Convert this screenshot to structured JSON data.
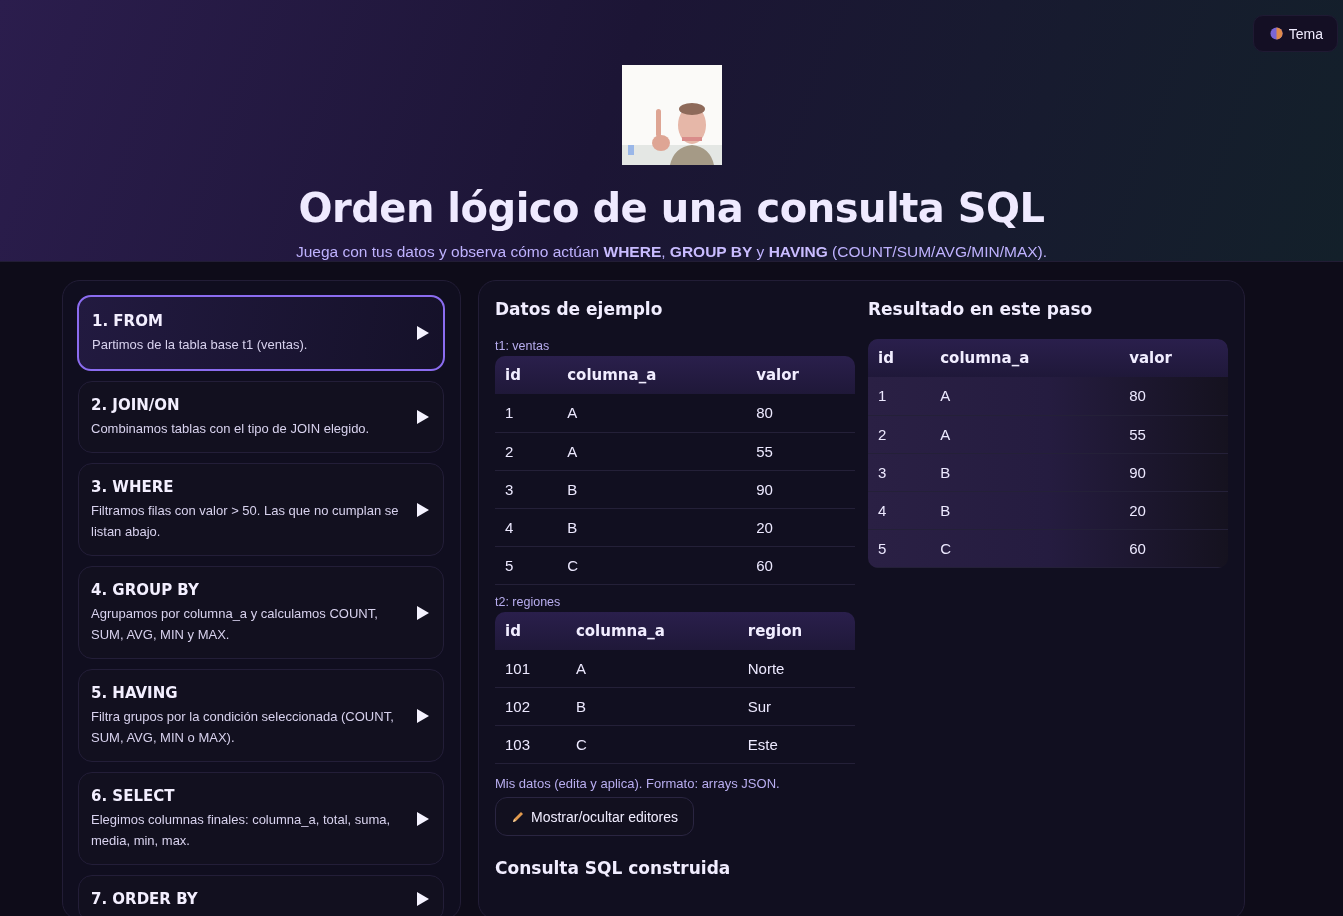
{
  "theme_button": {
    "label": "Tema"
  },
  "header": {
    "title": "Orden lógico de una consulta SQL",
    "subtitle": "Juega con tus datos y observa cómo actúan **WHERE**, **GROUP BY** y **HAVING** (COUNT/SUM/AVG/MIN/MAX)."
  },
  "steps": [
    {
      "title": "1. FROM",
      "description": "Partimos de la tabla base t1 (ventas).",
      "selected": true
    },
    {
      "title": "2. JOIN/ON",
      "description": "Combinamos tablas con el tipo de JOIN elegido.",
      "selected": false
    },
    {
      "title": "3. WHERE",
      "description": "Filtramos filas con valor > 50. Las que no cumplan se listan abajo.",
      "selected": false
    },
    {
      "title": "4. GROUP BY",
      "description": "Agrupamos por columna_a y calculamos COUNT, SUM, AVG, MIN y MAX.",
      "selected": false
    },
    {
      "title": "5. HAVING",
      "description": "Filtra grupos por la condición seleccionada (COUNT, SUM, AVG, MIN o MAX).",
      "selected": false
    },
    {
      "title": "6. SELECT",
      "description": "Elegimos columnas finales: columna_a, total, suma, media, min, max.",
      "selected": false
    },
    {
      "title": "7. ORDER BY",
      "selected": false
    }
  ],
  "sample_data": {
    "title": "Datos de ejemplo",
    "tables": [
      {
        "caption": "t1: ventas",
        "columns": [
          "id",
          "columna_a",
          "valor"
        ],
        "rows": [
          [
            "1",
            "A",
            "80"
          ],
          [
            "2",
            "A",
            "55"
          ],
          [
            "3",
            "B",
            "90"
          ],
          [
            "4",
            "B",
            "20"
          ],
          [
            "5",
            "C",
            "60"
          ]
        ]
      },
      {
        "caption": "t2: regiones",
        "columns": [
          "id",
          "columna_a",
          "region"
        ],
        "rows": [
          [
            "101",
            "A",
            "Norte"
          ],
          [
            "102",
            "B",
            "Sur"
          ],
          [
            "103",
            "C",
            "Este"
          ]
        ]
      }
    ],
    "hint": "Mis datos (edita y aplica). Formato: arrays JSON.",
    "editor_button": "Mostrar/ocultar editores"
  },
  "query_section": {
    "title": "Consulta SQL construida"
  },
  "result": {
    "title": "Resultado en este paso",
    "columns": [
      "id",
      "columna_a",
      "valor"
    ],
    "rows": [
      [
        "1",
        "A",
        "80"
      ],
      [
        "2",
        "A",
        "55"
      ],
      [
        "3",
        "B",
        "90"
      ],
      [
        "4",
        "B",
        "20"
      ],
      [
        "5",
        "C",
        "60"
      ]
    ]
  }
}
